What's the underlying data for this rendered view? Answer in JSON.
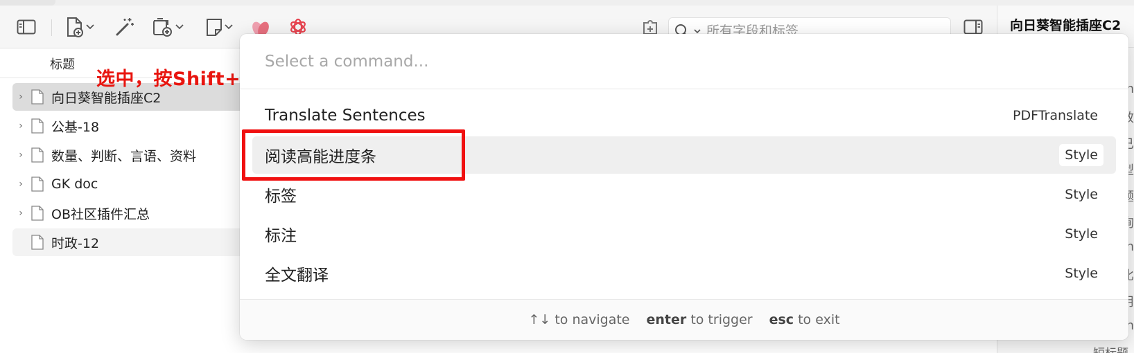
{
  "toolbar": {
    "search_placeholder": "所有字段和标签",
    "brand_color": "#e8434f"
  },
  "right_panel": {
    "title": "向日葵智能插座C2",
    "fragments": [
      "n",
      "效",
      "已",
      "型",
      "题",
      "询",
      "n",
      "比",
      "用",
      "n"
    ],
    "bottom_text": "短标题"
  },
  "file_list": {
    "column_header": "标题",
    "items": [
      {
        "label": "向日葵智能插座C2",
        "selected": true,
        "has_children": true
      },
      {
        "label": "公基-18",
        "selected": false,
        "has_children": true
      },
      {
        "label": "数量、判断、言语、资料",
        "selected": false,
        "has_children": true
      },
      {
        "label": "GK doc",
        "selected": false,
        "has_children": true
      },
      {
        "label": "OB社区插件汇总",
        "selected": false,
        "has_children": true
      },
      {
        "label": "时政-12",
        "selected": false,
        "has_children": false
      }
    ]
  },
  "annotation": {
    "text": "选中，按Shift+P键",
    "color": "#e8150f"
  },
  "command_palette": {
    "placeholder": "Select a command...",
    "items": [
      {
        "title": "Translate Sentences",
        "tag": "PDFTranslate",
        "active": false
      },
      {
        "title": "阅读高能进度条",
        "tag": "Style",
        "active": true
      },
      {
        "title": "标签",
        "tag": "Style",
        "active": false
      },
      {
        "title": "标注",
        "tag": "Style",
        "active": false
      },
      {
        "title": "全文翻译",
        "tag": "Style",
        "active": false
      }
    ],
    "footer": {
      "navigate_key": "↑↓",
      "navigate_text": "to navigate",
      "trigger_key": "enter",
      "trigger_text": "to trigger",
      "exit_key": "esc",
      "exit_text": "to exit"
    }
  }
}
